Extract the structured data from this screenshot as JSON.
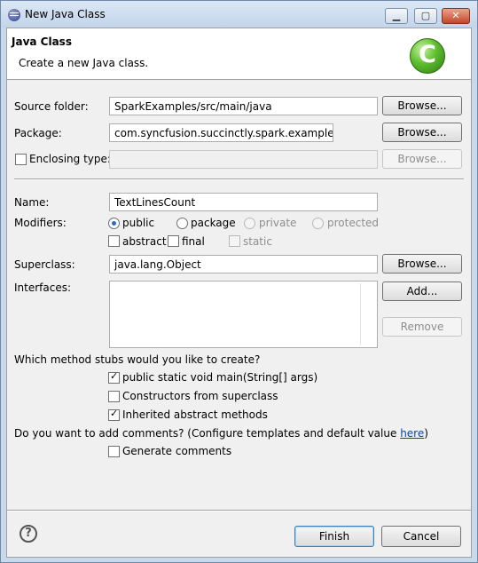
{
  "window": {
    "title": "New Java Class",
    "icon": "eclipse-app-icon",
    "controls": {
      "minimize": "▁",
      "maximize": "▢",
      "close": "✕"
    }
  },
  "banner": {
    "title": "Java Class",
    "message": "Create a new Java class.",
    "badge_letter": "C",
    "badge_color": "#5cbd2d"
  },
  "source_folder": {
    "label": "Source folder:",
    "value": "SparkExamples/src/main/java",
    "browse": "Browse..."
  },
  "package": {
    "label": "Package:",
    "value": "com.syncfusion.succinctly.spark.examples",
    "browse": "Browse..."
  },
  "enclosing_type": {
    "label": "Enclosing type:",
    "value": "",
    "browse": "Browse...",
    "checked": false
  },
  "name": {
    "label": "Name:",
    "value": "TextLinesCount"
  },
  "modifiers": {
    "label": "Modifiers:",
    "access": [
      {
        "label": "public",
        "selected": true,
        "enabled": true
      },
      {
        "label": "package",
        "selected": false,
        "enabled": true
      },
      {
        "label": "private",
        "selected": false,
        "enabled": false
      },
      {
        "label": "protected",
        "selected": false,
        "enabled": false
      }
    ],
    "flags": [
      {
        "label": "abstract",
        "checked": false,
        "enabled": true
      },
      {
        "label": "final",
        "checked": false,
        "enabled": true
      },
      {
        "label": "static",
        "checked": false,
        "enabled": false
      }
    ]
  },
  "superclass": {
    "label": "Superclass:",
    "value": "java.lang.Object",
    "browse": "Browse..."
  },
  "interfaces": {
    "label": "Interfaces:",
    "add": "Add...",
    "remove": "Remove"
  },
  "stubs": {
    "question": "Which method stubs would you like to create?",
    "options": [
      {
        "label": "public static void main(String[] args)",
        "checked": true
      },
      {
        "label": "Constructors from superclass",
        "checked": false
      },
      {
        "label": "Inherited abstract methods",
        "checked": true
      }
    ]
  },
  "comments": {
    "question_prefix": "Do you want to add comments? (Configure templates and default value ",
    "link": "here",
    "question_suffix": ")",
    "option": "Generate comments",
    "checked": false
  },
  "footer": {
    "help": "?",
    "finish": "Finish",
    "cancel": "Cancel"
  }
}
